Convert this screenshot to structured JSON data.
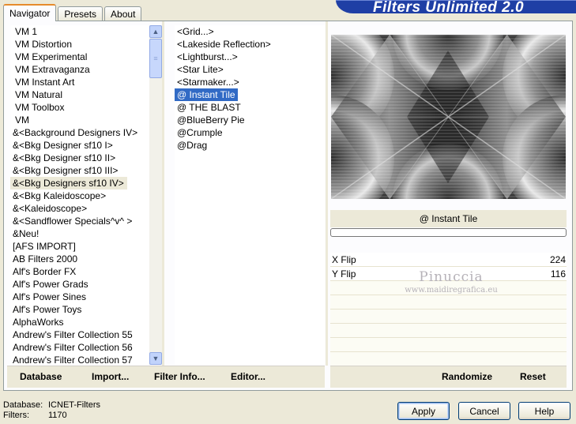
{
  "tabs": [
    "Navigator",
    "Presets",
    "About"
  ],
  "banner_title": "Filters Unlimited 2.0",
  "categories": [
    "VM 1",
    "VM Distortion",
    "VM Experimental",
    "VM Extravaganza",
    "VM Instant Art",
    "VM Natural",
    "VM Toolbox",
    "VM",
    "&<Background Designers IV>",
    "&<Bkg Designer sf10 I>",
    "&<Bkg Designer sf10 II>",
    "&<Bkg Designer sf10 III>",
    "&<Bkg Designers sf10 IV>",
    "&<Bkg Kaleidoscope>",
    "&<Kaleidoscope>",
    "&<Sandflower Specials^v^ >",
    "&Neu!",
    "[AFS IMPORT]",
    "AB Filters 2000",
    "Alf's Border FX",
    "Alf's Power Grads",
    "Alf's Power Sines",
    "Alf's Power Toys",
    "AlphaWorks",
    "Andrew's Filter Collection 55",
    "Andrew's Filter Collection 56",
    "Andrew's Filter Collection 57"
  ],
  "highlighted_category": "&<Bkg Designers sf10 IV>",
  "filters": [
    "<Grid...>",
    "<Lakeside Reflection>",
    "<Lightburst...>",
    "<Star Lite>",
    "<Starmaker...>",
    "@ Instant Tile",
    "@ THE BLAST",
    "@BlueBerry Pie",
    "@Crumple",
    "@Drag"
  ],
  "selected_filter": "@ Instant Tile",
  "filter_name": "@ Instant Tile",
  "params": [
    {
      "label": "X Flip",
      "value": "224"
    },
    {
      "label": "Y Flip",
      "value": "116"
    }
  ],
  "watermark": {
    "line1": "Pinuccia",
    "line2": "www.maidiregrafica.eu"
  },
  "strip_buttons": {
    "database": "Database",
    "import": "Import...",
    "filter_info": "Filter Info...",
    "editor": "Editor...",
    "randomize": "Randomize",
    "reset": "Reset"
  },
  "status": {
    "database_label": "Database:",
    "database_value": "ICNET-Filters",
    "filters_label": "Filters:",
    "filters_value": "1170"
  },
  "buttons": {
    "apply": "Apply",
    "cancel": "Cancel",
    "help": "Help"
  },
  "colors": {
    "banner": "#1f3fa5",
    "selection": "#316ac5",
    "tab_accent": "#e68b2c"
  },
  "icons": {
    "scroll_up": "scroll-up-icon",
    "scroll_down": "scroll-down-icon"
  }
}
